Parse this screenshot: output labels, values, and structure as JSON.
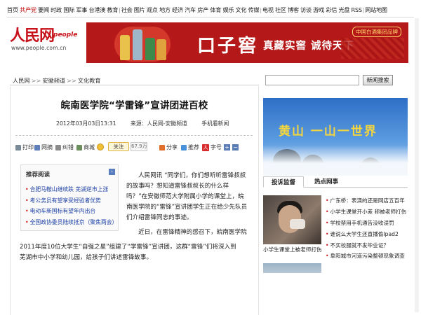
{
  "nav": {
    "items": [
      {
        "label": "首页",
        "hot": false
      },
      {
        "label": "共产党",
        "hot": true
      },
      {
        "label": "要闻",
        "hot": false
      },
      {
        "label": "时政",
        "hot": false
      },
      {
        "label": "国际",
        "hot": false
      },
      {
        "label": "军事",
        "hot": false
      },
      {
        "label": "台港澳",
        "hot": false
      },
      {
        "label": "教育",
        "hot": false
      },
      {
        "label": "社会",
        "hot": false
      },
      {
        "label": "图片",
        "hot": false
      },
      {
        "label": "观点",
        "hot": false
      },
      {
        "label": "地方",
        "hot": false
      },
      {
        "label": "经济",
        "hot": false
      },
      {
        "label": "汽车",
        "hot": false
      },
      {
        "label": "房产",
        "hot": false
      },
      {
        "label": "体育",
        "hot": false
      },
      {
        "label": "娱乐",
        "hot": false
      },
      {
        "label": "文化",
        "hot": false
      },
      {
        "label": "传媒",
        "hot": false
      },
      {
        "label": "电视",
        "hot": false
      },
      {
        "label": "社区",
        "hot": false
      },
      {
        "label": "博客",
        "hot": false
      },
      {
        "label": "访谈",
        "hot": false
      },
      {
        "label": "游戏",
        "hot": false
      },
      {
        "label": "彩信",
        "hot": false
      },
      {
        "label": "光盘",
        "hot": false
      },
      {
        "label": "RSS",
        "hot": false
      },
      {
        "label": "网站地图",
        "hot": false
      }
    ],
    "separators": [
      "|",
      "|",
      "|"
    ]
  },
  "logo": {
    "cn": "人民网",
    "en": "people",
    "url": "www.people.com.cn"
  },
  "banner": {
    "brand": "口子窖",
    "slogan": "真藏实窖 诚待天下",
    "tag": "中国白酒集团品牌",
    "colors": {
      "background": "#b51818",
      "text": "#ffffff",
      "tag": "#ffd36a"
    }
  },
  "breadcrumb": {
    "items": [
      "人民网",
      "安徽频道",
      "文化教育"
    ],
    "separator": ">>"
  },
  "search": {
    "value": "",
    "button_label": "新闻搜索"
  },
  "article": {
    "headline": "皖南医学院“学雷锋”宣讲团进百校",
    "date": "2012年03月03日13:31",
    "source": "来源：人民网-安徽频道",
    "mobile_link": "手机看新闻",
    "toolbar": {
      "print": "打印",
      "email": "网摘",
      "error": "纠错",
      "forum": "商城",
      "follow": "关注",
      "follow_count": "67.9万",
      "share": "分享",
      "recommend": "推荐",
      "font_icon": "人",
      "font_size": "字号",
      "font_plus": "+",
      "font_minus": "−"
    },
    "paragraphs": [
      "人民网讯 “同学们，你们想听听雷锋叔叔的故事吗？想知道雷锋叔叔长的什么样吗？”在安徽师范大学附属小学的课堂上，皖南医学院的“雷锋”宣讲团学生正在给少先队员们介绍雷锋同志的事迹。",
      "近日，在雷锋精神的感召下，皖南医学院"
    ],
    "paragraph2_cont1": "2011年度10位大学生“自强之星”组建了“学雷锋”宣讲团，这群“雷锋”们将深入到",
    "paragraph2_cont2": "芜湖市中小学和幼儿园，给孩子们讲述雷锋故事。"
  },
  "recommended": {
    "title": "推荐阅读",
    "more_icon": "›",
    "items": [
      "合肥马鞍山继续跌 芜湖逆市上涨",
      "考公务员有望享受经验者优势",
      "电动车新国标有望年内出台",
      "全国政协委员陆续抵京（聚焦两会）"
    ]
  },
  "sidebar": {
    "huangshan_title": "黄山 一山一世界",
    "tabs": [
      {
        "label": "投诉监督",
        "active": true
      },
      {
        "label": "热点网事",
        "active": false
      }
    ],
    "thumb_caption": "小学生课堂上被老师打伤",
    "news": [
      "广东桥：表演的还是网店五百年",
      "小学生课堂开小差 称被老师打伤",
      "学校禁用手机通告没收误罚",
      "谁说么大学生还直播偷Ipad2",
      "不买校服就不发毕业证？",
      "阜阳城市河道污染整顿现象调查"
    ]
  }
}
